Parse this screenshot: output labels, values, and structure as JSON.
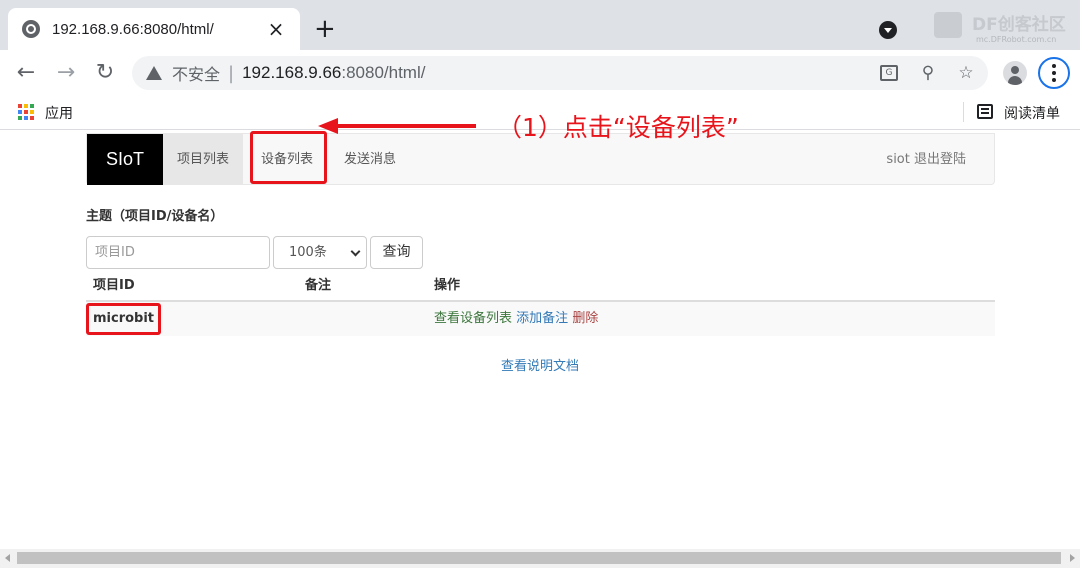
{
  "browser": {
    "tab_title": "192.168.9.66:8080/html/",
    "tab_close": "×",
    "new_tab": "+",
    "security_label": "不安全",
    "url_host": "192.168.9.66",
    "url_rest": ":8080/html/",
    "bookmarks": {
      "apps_label": "应用",
      "reading_list_label": "阅读清单"
    },
    "watermark": {
      "text": "DF创客社区",
      "sub": "mc.DFRobot.com.cn"
    },
    "icons": [
      "globe-icon",
      "back-icon",
      "forward-icon",
      "reload-icon",
      "warning-icon",
      "translate-icon",
      "zoom-icon",
      "star-icon",
      "profile-icon",
      "menu-icon",
      "apps-icon",
      "reading-list-icon"
    ]
  },
  "app": {
    "brand": "SIoT",
    "nav": [
      {
        "label": "项目列表",
        "active": true
      },
      {
        "label": "设备列表",
        "active": false
      },
      {
        "label": "发送消息",
        "active": false
      }
    ],
    "logout": "siot 退出登陆"
  },
  "filter": {
    "title": "主题（项目ID/设备名）",
    "project_id_placeholder": "项目ID",
    "limit_selected": "100条",
    "query_button": "查询"
  },
  "table": {
    "headers": [
      "项目ID",
      "备注",
      "操作"
    ],
    "rows": [
      {
        "project_id": "microbit",
        "note": "",
        "actions": [
          "查看设备列表",
          "添加备注",
          "删除"
        ]
      }
    ]
  },
  "doc_link": "查看说明文档",
  "annotation": {
    "text": "（1）点击“设备列表”",
    "color": "#e8141b"
  },
  "colors": {
    "brand_bg": "#000000",
    "link_green": "#3c763d",
    "link_blue": "#337ab7",
    "link_red": "#a94442"
  }
}
